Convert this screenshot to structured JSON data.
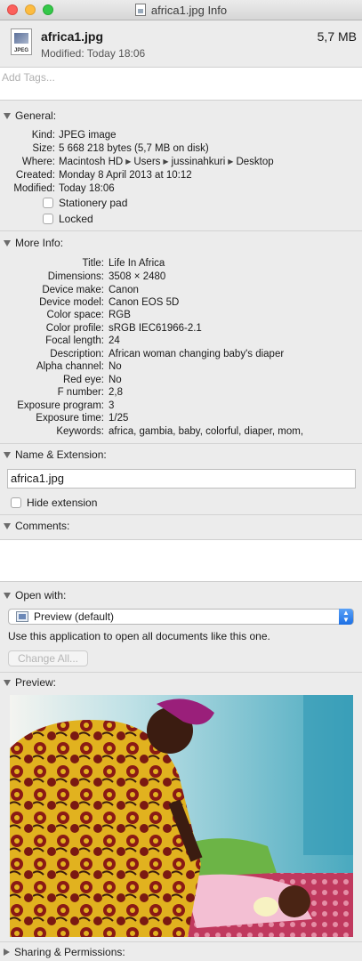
{
  "window": {
    "title": "africa1.jpg Info"
  },
  "header": {
    "icon_label": "JPEG",
    "file_name": "africa1.jpg",
    "file_size": "5,7 MB",
    "modified": "Modified: Today 18:06"
  },
  "tags": {
    "placeholder": "Add Tags..."
  },
  "general": {
    "header": "General:",
    "rows": [
      {
        "k": "Kind:",
        "v": "JPEG image"
      },
      {
        "k": "Size:",
        "v": "5 668 218 bytes (5,7 MB on disk)"
      },
      {
        "k": "Where:",
        "v": ""
      },
      {
        "k": "Created:",
        "v": "Monday 8 April 2013 at 10:12"
      },
      {
        "k": "Modified:",
        "v": "Today 18:06"
      }
    ],
    "where_path": [
      "Macintosh HD",
      "Users",
      "jussinahkuri",
      "Desktop"
    ],
    "stationery_label": "Stationery pad",
    "locked_label": "Locked"
  },
  "more_info": {
    "header": "More Info:",
    "rows": [
      {
        "k": "Title:",
        "v": "Life In Africa"
      },
      {
        "k": "Dimensions:",
        "v": "3508 × 2480"
      },
      {
        "k": "Device make:",
        "v": "Canon"
      },
      {
        "k": "Device model:",
        "v": "Canon EOS 5D"
      },
      {
        "k": "Color space:",
        "v": "RGB"
      },
      {
        "k": "Color profile:",
        "v": "sRGB IEC61966-2.1"
      },
      {
        "k": "Focal length:",
        "v": "24"
      },
      {
        "k": "Description:",
        "v": "African woman changing baby's diaper"
      },
      {
        "k": "Alpha channel:",
        "v": "No"
      },
      {
        "k": "Red eye:",
        "v": "No"
      },
      {
        "k": "F number:",
        "v": "2,8"
      },
      {
        "k": "Exposure program:",
        "v": "3"
      },
      {
        "k": "Exposure time:",
        "v": "1/25"
      },
      {
        "k": "Keywords:",
        "v": "africa, gambia, baby, colorful, diaper, mom,"
      }
    ]
  },
  "name_extension": {
    "header": "Name & Extension:",
    "value": "africa1.jpg",
    "hide_extension_label": "Hide extension"
  },
  "comments": {
    "header": "Comments:"
  },
  "open_with": {
    "header": "Open with:",
    "selected": "Preview (default)",
    "note": "Use this application to open all documents like this one.",
    "change_all_label": "Change All..."
  },
  "preview": {
    "header": "Preview:"
  },
  "sharing": {
    "header": "Sharing & Permissions:"
  },
  "colors": {
    "close": "#fc605c",
    "minimize": "#fdbc40",
    "maximize": "#34c84a",
    "select_accent": "#1c6fe4"
  }
}
